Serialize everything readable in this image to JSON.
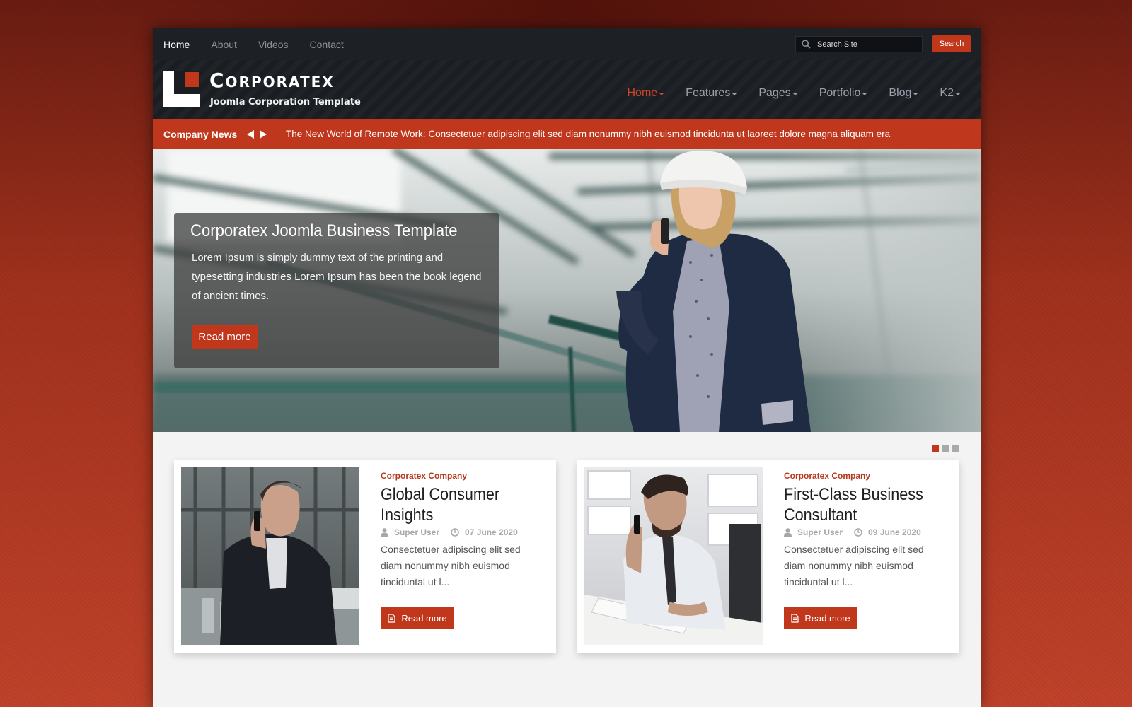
{
  "top_nav": {
    "items": [
      {
        "label": "Home",
        "active": true
      },
      {
        "label": "About",
        "active": false
      },
      {
        "label": "Videos",
        "active": false
      },
      {
        "label": "Contact",
        "active": false
      }
    ]
  },
  "search": {
    "placeholder": "Search Site",
    "button_label": "Search"
  },
  "brand": {
    "title": "Corporatex",
    "tagline": "Joomla Corporation Template",
    "logo_icon": "logo-mark"
  },
  "main_nav": {
    "items": [
      {
        "label": "Home",
        "active": true
      },
      {
        "label": "Features",
        "active": false
      },
      {
        "label": "Pages",
        "active": false
      },
      {
        "label": "Portfolio",
        "active": false
      },
      {
        "label": "Blog",
        "active": false
      },
      {
        "label": "K2",
        "active": false
      }
    ]
  },
  "ticker": {
    "label": "Company News",
    "headline": "The New World of Remote Work: Consectetuer adipiscing elit sed diam nonummy nibh euismod tincidunta ut laoreet dolore magna aliquam era"
  },
  "hero": {
    "title": "Corporatex Joomla Business Template",
    "text": "Lorem Ipsum is simply dummy text of the printing and typesetting industries Lorem Ipsum has been the book legend of ancient times.",
    "button_label": "Read more",
    "dots": 3,
    "active_dot": 0
  },
  "articles": [
    {
      "category": "Corporatex Company",
      "title": "Global Consumer Insights",
      "author": "Super User",
      "date": "07 June 2020",
      "excerpt": "Consectetuer adipiscing elit sed diam nonummy nibh euismod tinciduntal ut l...",
      "button_label": "Read more"
    },
    {
      "category": "Corporatex Company",
      "title": "First-Class Business Consultant",
      "author": "Super User",
      "date": "09 June 2020",
      "excerpt": "Consectetuer adipiscing elit sed diam nonummy nibh euismod tinciduntal ut l...",
      "button_label": "Read more"
    }
  ],
  "colors": {
    "accent": "#c0371c",
    "dark_bar": "#1d2126",
    "header": "#1a1d21",
    "content_bg": "#f3f3f3"
  }
}
